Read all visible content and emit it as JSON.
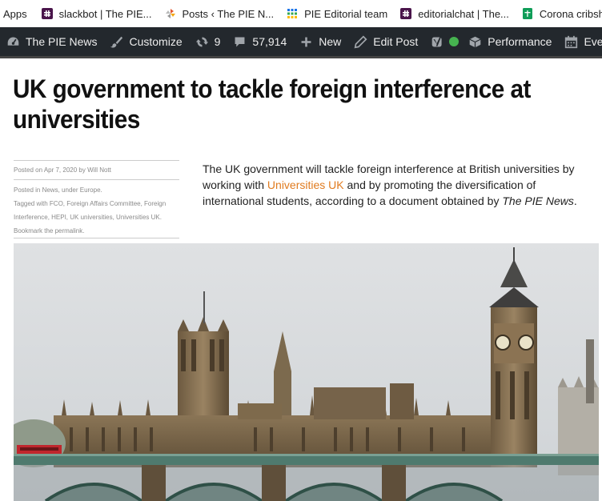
{
  "bookmarks": {
    "items": [
      {
        "label": "Apps"
      },
      {
        "label": "slackbot | The PIE..."
      },
      {
        "label": "Posts ‹ The PIE N..."
      },
      {
        "label": "PIE Editorial team"
      },
      {
        "label": "editorialchat | The..."
      },
      {
        "label": "Corona cribsh"
      }
    ]
  },
  "adminbar": {
    "site": "The PIE News",
    "customize": "Customize",
    "updates": "9",
    "comments": "57,914",
    "new": "New",
    "edit": "Edit Post",
    "performance": "Performance",
    "events": "Eve"
  },
  "article": {
    "title": "UK government to tackle foreign interference at universities",
    "posted_prefix": "Posted on ",
    "posted_date": "Apr 7, 2020",
    "posted_by": " by ",
    "author": "Will Nott",
    "posted_in_prefix": "Posted in ",
    "category": "News",
    "under": ", under ",
    "region": "Europe",
    "period": ".",
    "tagged_prefix": "Tagged with ",
    "tags": "FCO, Foreign Affairs Committee, Foreign Interference, HEPI, UK universities, Universities UK.",
    "bookmark_prefix": "Bookmark the ",
    "permalink": "permalink",
    "lead_1": "The UK government will tackle foreign interference at British universities by working with ",
    "lead_link": "Universities UK",
    "lead_2": " and by promoting the diversification of international students, according to a document obtained by ",
    "lead_em": "The PIE News",
    "lead_end": "."
  },
  "colors": {
    "adminbar_bg": "#23282d",
    "link_orange": "#e07b1f",
    "status_green": "#46b450"
  }
}
